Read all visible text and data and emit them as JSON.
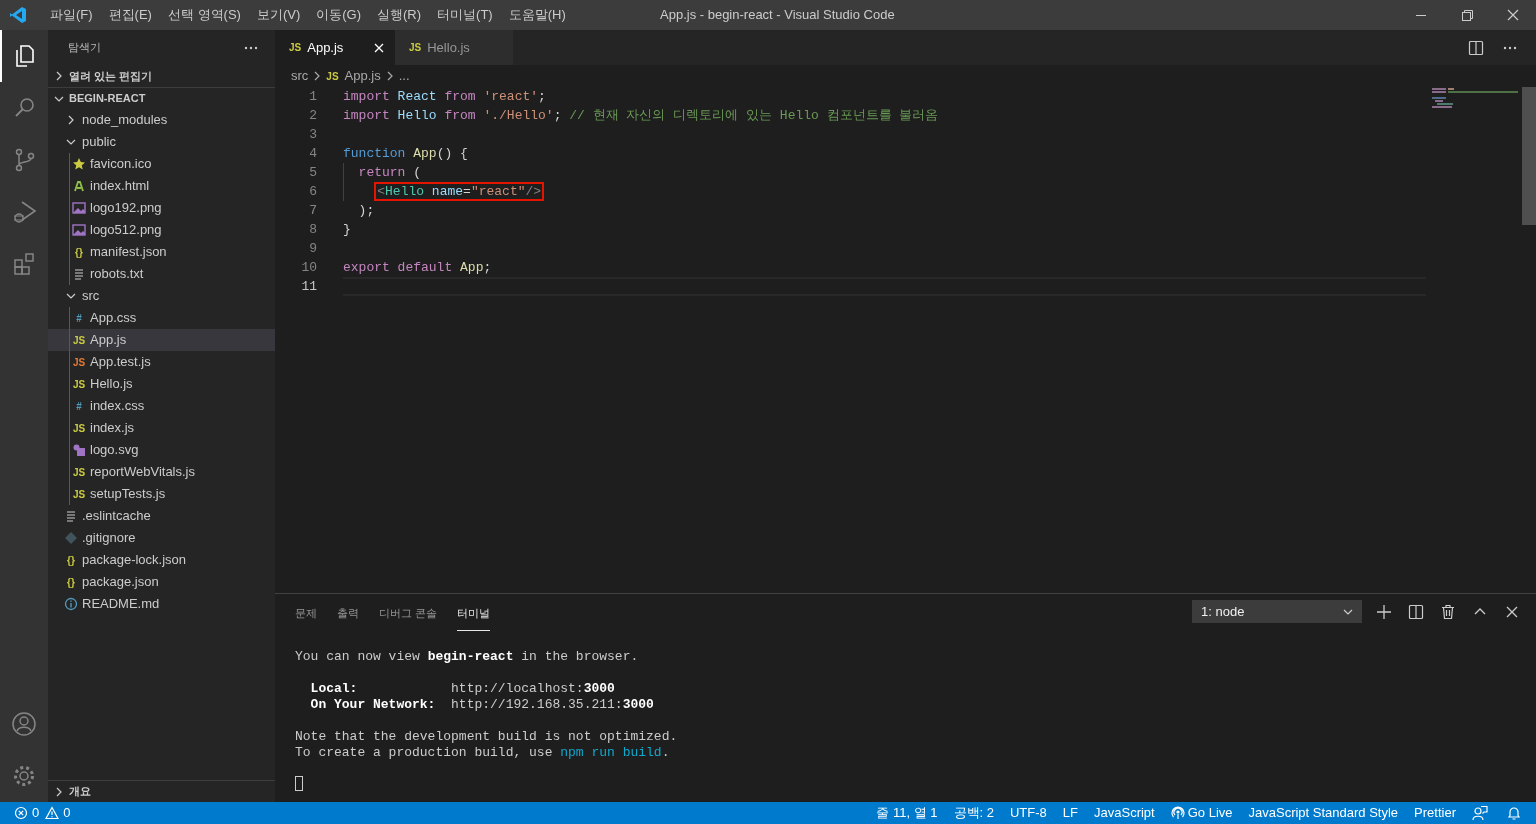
{
  "window": {
    "title": "App.js - begin-react - Visual Studio Code"
  },
  "menu": [
    "파일(F)",
    "편집(E)",
    "선택 영역(S)",
    "보기(V)",
    "이동(G)",
    "실행(R)",
    "터미널(T)",
    "도움말(H)"
  ],
  "activity_bar": [
    {
      "selected": true
    },
    {
      "selected": false
    },
    {
      "selected": false
    },
    {
      "selected": false
    },
    {
      "selected": false
    }
  ],
  "explorer": {
    "title": "탐색기",
    "open_editors": {
      "label": "열려 있는 편집기",
      "expanded": false
    },
    "project": {
      "label": "BEGIN-REACT",
      "expanded": true,
      "children": [
        {
          "label": "node_modules",
          "kind": "folder",
          "expanded": false
        },
        {
          "label": "public",
          "kind": "folder",
          "expanded": true,
          "children": [
            {
              "label": "favicon.ico",
              "kind": "star",
              "selected": false
            },
            {
              "label": "index.html",
              "kind": "html",
              "selected": false
            },
            {
              "label": "logo192.png",
              "kind": "image",
              "selected": false
            },
            {
              "label": "logo512.png",
              "kind": "image",
              "selected": false
            },
            {
              "label": "manifest.json",
              "kind": "json",
              "badge": "{}",
              "selected": false
            },
            {
              "label": "robots.txt",
              "kind": "text",
              "selected": false
            }
          ]
        },
        {
          "label": "src",
          "kind": "folder",
          "expanded": true,
          "children": [
            {
              "label": "App.css",
              "kind": "css",
              "badge": "#",
              "selected": false
            },
            {
              "label": "App.js",
              "kind": "js",
              "badge": "JS",
              "selected": true
            },
            {
              "label": "App.test.js",
              "kind": "test",
              "badge": "JS",
              "selected": false
            },
            {
              "label": "Hello.js",
              "kind": "js",
              "badge": "JS",
              "selected": false
            },
            {
              "label": "index.css",
              "kind": "css",
              "badge": "#",
              "selected": false
            },
            {
              "label": "index.js",
              "kind": "js",
              "badge": "JS",
              "selected": false
            },
            {
              "label": "logo.svg",
              "kind": "svg",
              "selected": false
            },
            {
              "label": "reportWebVitals.js",
              "kind": "js",
              "badge": "JS",
              "selected": false
            },
            {
              "label": "setupTests.js",
              "kind": "js",
              "badge": "JS",
              "selected": false
            }
          ]
        },
        {
          "label": ".eslintcache",
          "kind": "text",
          "selected": false
        },
        {
          "label": ".gitignore",
          "kind": "git",
          "selected": false
        },
        {
          "label": "package-lock.json",
          "kind": "json",
          "badge": "{}",
          "selected": false
        },
        {
          "label": "package.json",
          "kind": "json",
          "badge": "{}",
          "selected": false
        },
        {
          "label": "README.md",
          "kind": "info",
          "selected": false
        }
      ]
    },
    "outline": {
      "label": "개요",
      "expanded": false
    }
  },
  "tabs": [
    {
      "label": "App.js",
      "badge": "JS",
      "selected": true
    },
    {
      "label": "Hello.js",
      "badge": "JS",
      "selected": false
    }
  ],
  "breadcrumb": [
    {
      "label": "src"
    },
    {
      "label": "App.js",
      "badge": "JS"
    },
    {
      "label": "..."
    }
  ],
  "code": [
    {
      "number": "1",
      "tokens": [
        {
          "text": "import ",
          "kind": "keyword"
        },
        {
          "text": "React ",
          "kind": "variable"
        },
        {
          "text": "from ",
          "kind": "keyword"
        },
        {
          "text": "'react'",
          "kind": "string"
        },
        {
          "text": ";",
          "kind": "plain"
        }
      ]
    },
    {
      "number": "2",
      "tokens": [
        {
          "text": "import ",
          "kind": "keyword"
        },
        {
          "text": "Hello ",
          "kind": "variable"
        },
        {
          "text": "from ",
          "kind": "keyword"
        },
        {
          "text": "'./Hello'",
          "kind": "string"
        },
        {
          "text": "; ",
          "kind": "plain"
        },
        {
          "text": "// 현재 자신의 디렉토리에 있는 Hello 컴포넌트를 불러옴",
          "kind": "comment"
        }
      ]
    },
    {
      "number": "3"
    },
    {
      "number": "4",
      "tokens": [
        {
          "text": "function ",
          "kind": "storage"
        },
        {
          "text": "App",
          "kind": "function"
        },
        {
          "text": "() {",
          "kind": "plain"
        }
      ]
    },
    {
      "number": "5",
      "tokens": [
        {
          "text": "  return",
          "kind": "keyword"
        },
        {
          "text": " (",
          "kind": "plain"
        }
      ]
    },
    {
      "number": "6",
      "boxed": true,
      "tokens": [
        {
          "text": "    <",
          "kind": "bracket"
        },
        {
          "text": "Hello ",
          "kind": "tag"
        },
        {
          "text": "name",
          "kind": "variable"
        },
        {
          "text": "=",
          "kind": "plain"
        },
        {
          "text": "\"react\"",
          "kind": "string"
        },
        {
          "text": "/>",
          "kind": "bracket"
        }
      ]
    },
    {
      "number": "7",
      "tokens": [
        {
          "text": "  );",
          "kind": "plain"
        }
      ]
    },
    {
      "number": "8",
      "tokens": [
        {
          "text": "}",
          "kind": "plain"
        }
      ]
    },
    {
      "number": "9"
    },
    {
      "number": "10",
      "tokens": [
        {
          "text": "export ",
          "kind": "keyword"
        },
        {
          "text": "default ",
          "kind": "keyword"
        },
        {
          "text": "App",
          "kind": "function"
        },
        {
          "text": ";",
          "kind": "plain"
        }
      ]
    },
    {
      "number": "11",
      "current": true
    }
  ],
  "panel": {
    "tabs": [
      {
        "label": "문제",
        "selected": false
      },
      {
        "label": "출력",
        "selected": false
      },
      {
        "label": "디버그 콘솔",
        "selected": false
      },
      {
        "label": "터미널",
        "selected": true
      }
    ],
    "terminal_select": "1: node",
    "terminal": [
      {
        "segments": [
          {
            "text": "You can now view ",
            "kind": "plain"
          },
          {
            "text": "begin-react",
            "kind": "bold"
          },
          {
            "text": " in the browser.",
            "kind": "plain"
          }
        ]
      },
      {
        "kind": "blank"
      },
      {
        "segments": [
          {
            "text": "  Local:",
            "kind": "bold"
          },
          {
            "text": "            http://localhost:",
            "kind": "plain"
          },
          {
            "text": "3000",
            "kind": "bold"
          }
        ]
      },
      {
        "segments": [
          {
            "text": "  On Your Network:",
            "kind": "bold"
          },
          {
            "text": "  http://192.168.35.211:",
            "kind": "plain"
          },
          {
            "text": "3000",
            "kind": "bold"
          }
        ]
      },
      {
        "kind": "blank"
      },
      {
        "segments": [
          {
            "text": "Note that the development build is not optimized.",
            "kind": "plain"
          }
        ]
      },
      {
        "segments": [
          {
            "text": "To create a production build, use ",
            "kind": "plain"
          },
          {
            "text": "npm run build",
            "kind": "command"
          },
          {
            "text": ".",
            "kind": "plain"
          }
        ]
      },
      {
        "kind": "blank"
      },
      {
        "kind": "cursor"
      }
    ]
  },
  "status_bar": {
    "errors": "0",
    "warnings": "0",
    "items": [
      {
        "text": "줄 11, 열 1",
        "kind": "text"
      },
      {
        "text": "공백: 2",
        "kind": "text"
      },
      {
        "text": "UTF-8",
        "kind": "text"
      },
      {
        "text": "LF",
        "kind": "text"
      },
      {
        "text": "JavaScript",
        "kind": "text"
      },
      {
        "text": "Go Live",
        "kind": "live"
      },
      {
        "text": "JavaScript Standard Style",
        "kind": "text"
      },
      {
        "text": "Prettier",
        "kind": "text"
      },
      {
        "kind": "feedback"
      },
      {
        "kind": "bell"
      }
    ]
  }
}
